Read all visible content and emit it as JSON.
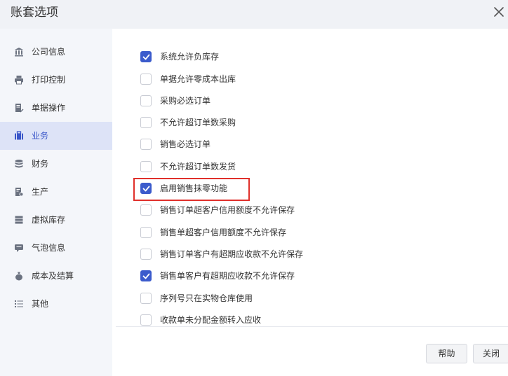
{
  "dialog": {
    "title": "账套选项",
    "close_icon": "close-icon"
  },
  "sidebar": {
    "items": [
      {
        "label": "公司信息",
        "icon": "building-icon",
        "active": false
      },
      {
        "label": "打印控制",
        "icon": "printer-icon",
        "active": false
      },
      {
        "label": "单据操作",
        "icon": "document-edit-icon",
        "active": false
      },
      {
        "label": "业务",
        "icon": "briefcase-icon",
        "active": true
      },
      {
        "label": "财务",
        "icon": "coins-stack-icon",
        "active": false
      },
      {
        "label": "生产",
        "icon": "production-doc-icon",
        "active": false
      },
      {
        "label": "虚拟库存",
        "icon": "inventory-list-icon",
        "active": false
      },
      {
        "label": "气泡信息",
        "icon": "chat-bubble-icon",
        "active": false
      },
      {
        "label": "成本及结算",
        "icon": "money-bag-icon",
        "active": false
      },
      {
        "label": "其他",
        "icon": "list-icon",
        "active": false
      }
    ]
  },
  "options": [
    {
      "label": "系统允许负库存",
      "checked": true
    },
    {
      "label": "单据允许零成本出库",
      "checked": false
    },
    {
      "label": "采购必选订单",
      "checked": false
    },
    {
      "label": "不允许超订单数采购",
      "checked": false
    },
    {
      "label": "销售必选订单",
      "checked": false
    },
    {
      "label": "不允许超订单数发货",
      "checked": false
    },
    {
      "label": "启用销售抹零功能",
      "checked": true
    },
    {
      "label": "销售订单超客户信用额度不允许保存",
      "checked": false
    },
    {
      "label": "销售单超客户信用额度不允许保存",
      "checked": false
    },
    {
      "label": "销售订单客户有超期应收款不允许保存",
      "checked": false
    },
    {
      "label": "销售单客户有超期应收款不允许保存",
      "checked": true
    },
    {
      "label": "序列号只在实物仓库使用",
      "checked": false
    },
    {
      "label": "收款单未分配金额转入应收",
      "checked": false
    }
  ],
  "footer": {
    "help_label": "帮助",
    "close_label": "关闭"
  },
  "colors": {
    "accent": "#3b5bcc",
    "highlight_border": "#e0302b",
    "sidebar_bg": "#f4f6fa",
    "active_bg": "#dde3f7"
  }
}
